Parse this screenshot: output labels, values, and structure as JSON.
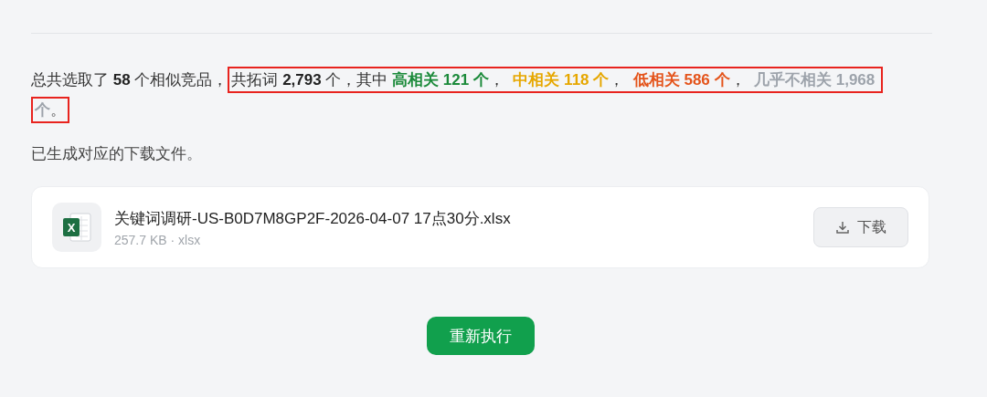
{
  "summary": {
    "lead": [
      {
        "text": "总共选取了 ",
        "kind": "plain"
      },
      {
        "text": "58",
        "kind": "number"
      },
      {
        "text": " 个相似竞品，",
        "kind": "plain"
      }
    ],
    "annotated": [
      {
        "text": "共拓词 ",
        "kind": "plain"
      },
      {
        "text": "2,793",
        "kind": "number"
      },
      {
        "text": " 个，其中 ",
        "kind": "plain"
      },
      {
        "text": "高相关 121 个",
        "kind": "high"
      },
      {
        "text": "，  ",
        "kind": "plain"
      },
      {
        "text": "中相关 118 个",
        "kind": "mid"
      },
      {
        "text": "，  ",
        "kind": "plain"
      },
      {
        "text": "低相关 586 个",
        "kind": "low"
      },
      {
        "text": "，  ",
        "kind": "plain"
      },
      {
        "text": "几乎不相关 1,968 个",
        "kind": "none"
      },
      {
        "text": "。",
        "kind": "plain"
      }
    ]
  },
  "note": "已生成对应的下载文件。",
  "file": {
    "name": "关键词调研-US-B0D7M8GP2F-2026-04-07 17点30分.xlsx",
    "meta": "257.7 KB · xlsx",
    "icon_letter": "X",
    "action": "下载"
  },
  "rerun_button": "重新执行"
}
